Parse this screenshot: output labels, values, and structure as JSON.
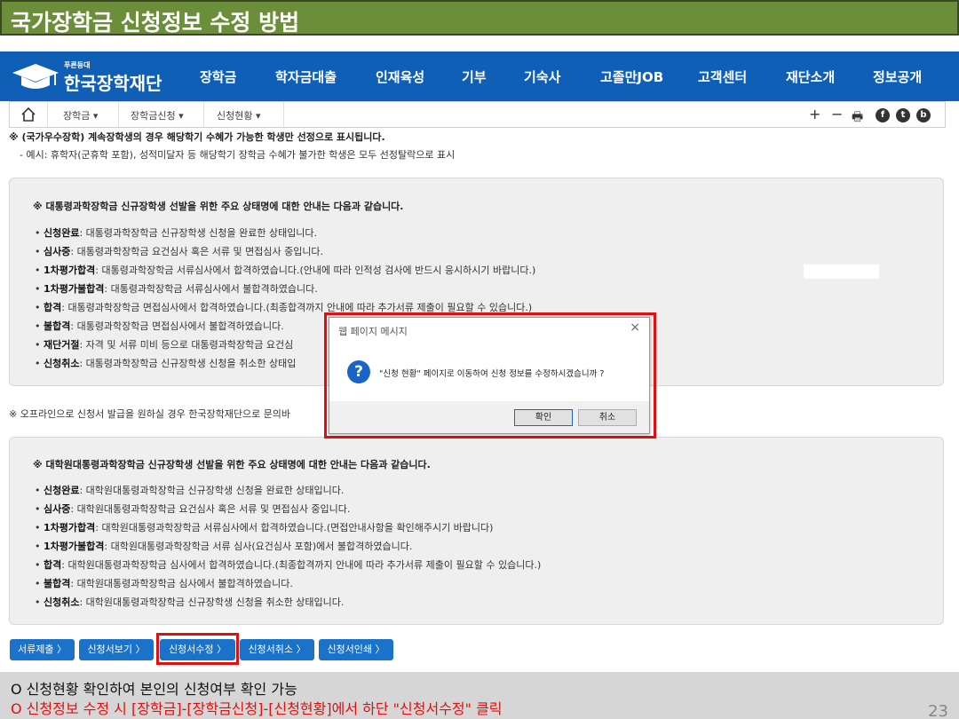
{
  "slide": {
    "title": "국가장학금 신청정보 수정 방법",
    "page_number": "23"
  },
  "logo": {
    "small": "푸른등대",
    "name": "한국장학재단"
  },
  "nav": [
    "장학금",
    "학자금대출",
    "인재육성",
    "기부",
    "기숙사",
    "고졸만JOB",
    "고객센터",
    "재단소개",
    "정보공개"
  ],
  "breadcrumb": [
    "장학금",
    "장학금신청",
    "신청현황"
  ],
  "tools": {
    "plus": "+",
    "minus": "−",
    "print": "🖶",
    "icon1": "f",
    "icon2": "t",
    "icon3": "b"
  },
  "notice": {
    "line1": "※ (국가우수장학) 계속장학생의 경우 해당학기 수혜가 가능한 학생만 선정으로 표시됩니다.",
    "line2": "- 예시: 휴학자(군휴학 포함), 성적미달자 등 해당학기 장학금 수혜가 불가한 학생은 모두 선정탈락으로 표시"
  },
  "box1": {
    "heading": "※ 대통령과학장학금 신규장학생 선발을 위한 주요 상태명에 대한 안내는 다음과 같습니다.",
    "items": [
      {
        "term": "신청완료",
        "desc": ": 대통령과학장학금 신규장학생 신청을 완료한 상태입니다."
      },
      {
        "term": "심사중",
        "desc": ": 대통령과학장학금 요건심사 혹은 서류 및 면접심사 중입니다."
      },
      {
        "term": "1차평가합격",
        "desc": ": 대통령과학장학금 서류심사에서 합격하였습니다.(안내에 따라 인적성 검사에 반드시 응시하시기 바랍니다.)"
      },
      {
        "term": "1차평가불합격",
        "desc": ": 대통령과학장학금 서류심사에서 불합격하였습니다."
      },
      {
        "term": "합격",
        "desc": ": 대통령과학장학금 면접심사에서 합격하였습니다.(최종합격까지 안내에 따라 추가서류 제출이 필요할 수 있습니다.)"
      },
      {
        "term": "불합격",
        "desc": ": 대통령과학장학금 면접심사에서 불합격하였습니다."
      },
      {
        "term": "재단거절",
        "desc": ": 자격 및 서류 미비 등으로 대통령과학장학금 요건심"
      },
      {
        "term": "신청취소",
        "desc": ": 대통령과학장학금 신규장학생 신청을 취소한 상태입"
      }
    ]
  },
  "offline_notice": "※ 오프라인으로 신청서 발급을 원하실 경우 한국장학재단으로 문의바",
  "box2": {
    "heading": "※ 대학원대통령과학장학금 신규장학생 선발을 위한 주요 상태명에 대한 안내는 다음과 같습니다.",
    "items": [
      {
        "term": "신청완료",
        "desc": ": 대학원대통령과학장학금 신규장학생 신청을 완료한 상태입니다."
      },
      {
        "term": "심사중",
        "desc": ": 대학원대통령과학장학금 요건심사 혹은 서류 및 면접심사 중입니다."
      },
      {
        "term": "1차평가합격",
        "desc": ": 대학원대통령과학장학금 서류심사에서 합격하였습니다.(면접안내사항을 확인해주시기 바랍니다)"
      },
      {
        "term": "1차평가불합격",
        "desc": ": 대학원대통령과학장학금 서류 심사(요건심사 포함)에서 불합격하였습니다."
      },
      {
        "term": "합격",
        "desc": ": 대학원대통령과학장학금 심사에서 합격하였습니다.(최종합격까지 안내에 따라 추가서류 제출이 필요할 수 있습니다.)"
      },
      {
        "term": "불합격",
        "desc": ": 대학원대통령과학장학금 심사에서 불합격하였습니다."
      },
      {
        "term": "신청취소",
        "desc": ": 대학원대통령과학장학금 신규장학생 신청을 취소한 상태입니다."
      }
    ]
  },
  "dialog": {
    "title": "웹 페이지 메시지",
    "close": "×",
    "icon": "?",
    "message": "\"신청 현황\" 페이지로 이동하여 신청 정보를 수정하시겠습니까 ?",
    "ok": "확인",
    "cancel": "취소"
  },
  "buttons": [
    "서류제출 〉",
    "신청서보기 〉",
    "신청서수정 〉",
    "신청서취소 〉",
    "신청서인쇄 〉"
  ],
  "footer": {
    "line1": "O 신청현황 확인하여 본인의 신청여부 확인 가능",
    "line2": "O 신청정보 수정 시 [장학금]-[장학금신청]-[신청현황]에서  하단 \"신청서수정\" 클릭"
  },
  "colors": {
    "title_bar": "#6b8e3a",
    "nav": "#0f5fb6",
    "button": "#1a73c8",
    "highlight": "#e01010",
    "footer_red": "#e01010"
  }
}
